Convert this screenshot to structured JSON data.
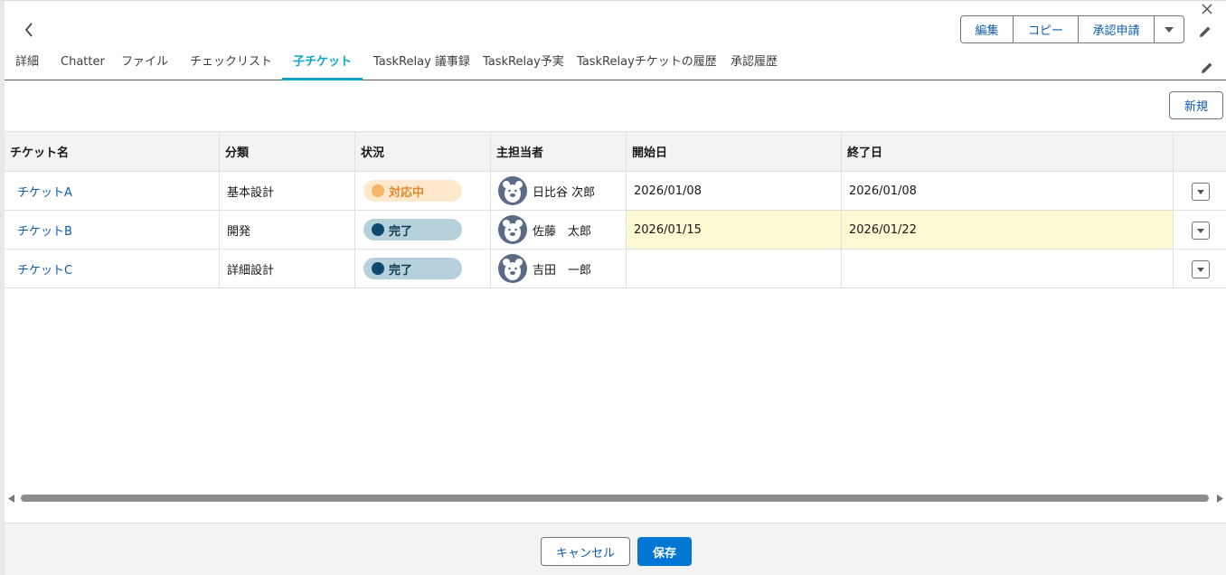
{
  "header": {
    "actions": [
      "編集",
      "コピー",
      "承認申請"
    ]
  },
  "tabs": [
    {
      "label": "詳細",
      "active": false
    },
    {
      "label": "Chatter",
      "active": false
    },
    {
      "label": "ファイル",
      "active": false
    },
    {
      "label": "チェックリスト",
      "active": false
    },
    {
      "label": "子チケット",
      "active": true
    },
    {
      "label": "TaskRelay 議事録",
      "active": false
    },
    {
      "label": "TaskRelay予実",
      "active": false
    },
    {
      "label": "TaskRelayチケットの履歴",
      "active": false
    },
    {
      "label": "承認履歴",
      "active": false
    }
  ],
  "list": {
    "new_label": "新規",
    "columns": [
      "チケット名",
      "分類",
      "状況",
      "主担当者",
      "開始日",
      "終了日"
    ],
    "rows": [
      {
        "name": "チケットA",
        "category": "基本設計",
        "status": "対応中",
        "status_color": "orange",
        "owner": "日比谷 次郎",
        "start": "2026/01/08",
        "end": "2026/01/08"
      },
      {
        "name": "チケットB",
        "category": "開発",
        "status": "完了",
        "status_color": "blue",
        "owner": "佐藤　太郎",
        "start": "2026/01/15",
        "end": "2026/01/22",
        "highlight_dates": true
      },
      {
        "name": "チケットC",
        "category": "詳細設計",
        "status": "完了",
        "status_color": "blue",
        "owner": "吉田　一郎",
        "start": "",
        "end": ""
      }
    ]
  },
  "footer": {
    "cancel_label": "キャンセル",
    "save_label": "保存"
  },
  "colors": {
    "accent": "#0ea5c9",
    "link": "#0b5cab",
    "primary_button": "#0176d3",
    "highlight": "#fdf9d3"
  }
}
